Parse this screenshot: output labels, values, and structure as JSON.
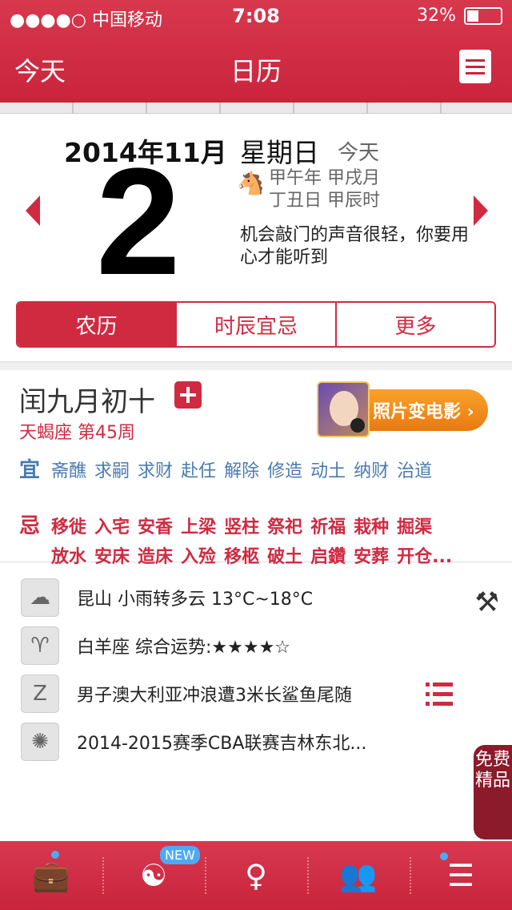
{
  "status_bar": {
    "carrier": "●●●●○ 中国移动",
    "time": "7:08",
    "battery": "32%"
  },
  "nav": {
    "left": "今天",
    "title": "日历"
  },
  "date_card": {
    "year_month": "2014年11月",
    "day": "2",
    "weekday": "星期日",
    "today_label": "今天",
    "ganzhi_line1": "甲午年 甲戌月",
    "ganzhi_line2": "丁丑日 甲辰时",
    "fortune": "机会敲门的声音很轻，你要用心才能听到"
  },
  "tabs": [
    "农历",
    "时辰宜忌",
    "更多"
  ],
  "lunar": {
    "date": "闰九月初十",
    "zodiac_week": "天蝎座 第45周",
    "promo_label": "照片变电影 ›",
    "yi_mark": "宜",
    "yi_items": [
      "斋醮",
      "求嗣",
      "求财",
      "赴任",
      "解除",
      "修造",
      "动土",
      "纳财",
      "治道"
    ],
    "ji_mark": "忌",
    "ji_items_line1": [
      "移徙",
      "入宅",
      "安香",
      "上梁",
      "竖柱",
      "祭祀",
      "祈福",
      "栽种",
      "掘渠"
    ],
    "ji_items_line2": [
      "放水",
      "安床",
      "造床",
      "入殓",
      "移柩",
      "破土",
      "启鑽",
      "安葬",
      "开仓..."
    ]
  },
  "info": {
    "weather": "昆山 小雨转多云 13°C~18°C",
    "horoscope": "白羊座 综合运势:★★★★☆",
    "news": "男子澳大利亚冲浪遭3米长鲨鱼尾随",
    "sports": "2014-2015赛季CBA联赛吉林东北..."
  },
  "side_tab": "免费精品",
  "bottom": {
    "new_badge": "NEW"
  },
  "colors": {
    "accent": "#d02a41",
    "yi": "#4a7bb0",
    "promo": "#f08c1a"
  }
}
